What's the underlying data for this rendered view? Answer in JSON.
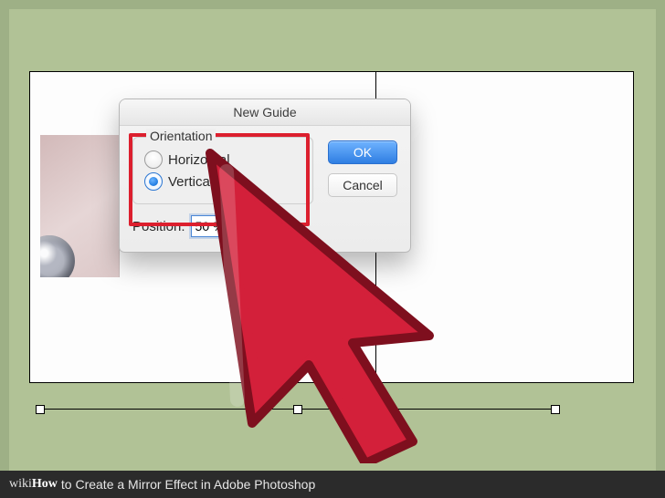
{
  "dialog": {
    "title": "New Guide",
    "orientation": {
      "legend": "Orientation",
      "horizontal": "Horizontal",
      "vertical": "Vertical",
      "selected": "vertical"
    },
    "position": {
      "label": "Position:",
      "value": "50 %"
    },
    "buttons": {
      "ok": "OK",
      "cancel": "Cancel"
    }
  },
  "footer": {
    "brand_prefix": "wiki",
    "brand_suffix": "How",
    "article": " to Create a Mirror Effect in Adobe Photoshop"
  },
  "colors": {
    "highlight": "#dc1f2e",
    "accent": "#2f7ee2"
  }
}
